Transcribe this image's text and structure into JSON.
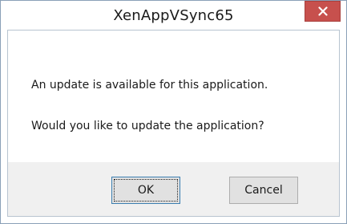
{
  "window": {
    "title": "XenAppVSync65",
    "close_icon": "close-icon",
    "close_color": "#c7504d"
  },
  "message": {
    "line1": "An update is available for this application.",
    "line2": "Would you like to update the application?"
  },
  "buttons": {
    "ok_label": "OK",
    "cancel_label": "Cancel"
  }
}
